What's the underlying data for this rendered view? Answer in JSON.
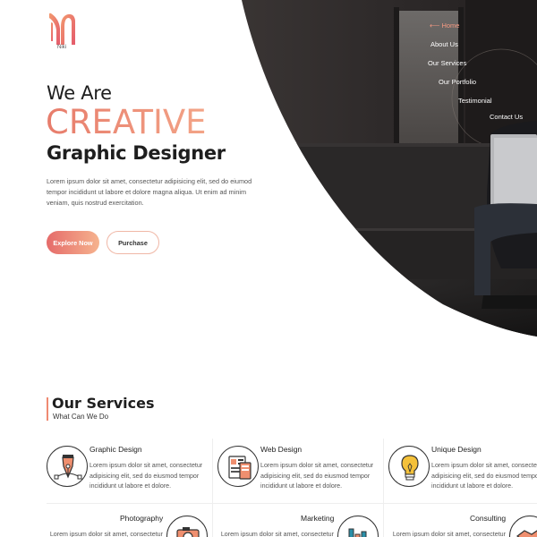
{
  "brand": {
    "name": "Niki",
    "colors": {
      "accent_start": "#e56b6a",
      "accent_end": "#f6b38e",
      "text_dark": "#1e1e1e"
    }
  },
  "nav": {
    "items": [
      {
        "label": "Home",
        "active": true
      },
      {
        "label": "About Us",
        "active": false
      },
      {
        "label": "Our Services",
        "active": false
      },
      {
        "label": "Our Portfolio",
        "active": false
      },
      {
        "label": "Testimonial",
        "active": false
      },
      {
        "label": "Contact Us",
        "active": false
      }
    ],
    "active_icon": "arrow-left-icon"
  },
  "hero": {
    "line1": "We Are",
    "line2": "CREATIVE",
    "line3": "Graphic Designer",
    "description": "Lorem ipsum dolor sit amet, consectetur adipisicing elit, sed do eiumod tempor incididunt ut labore et dolore magna aliqua. Ut enim ad minim veniam, quis nostrud exercitation.",
    "primary_button": "Explore Now",
    "secondary_button": "Purchase"
  },
  "services": {
    "title": "Our Services",
    "subtitle": "What Can We Do",
    "items": [
      {
        "title": "Graphic Design",
        "icon": "pen-tool-icon",
        "description": "Lorem ipsum dolor sit amet, consectetur adipisicing elit, sed do eiusmod tempor incididunt ut labore et dolore."
      },
      {
        "title": "Web Design",
        "icon": "web-layout-icon",
        "description": "Lorem ipsum dolor sit amet, consectetur adipisicing elit, sed do eiusmod tempor incididunt ut labore et dolore."
      },
      {
        "title": "Unique Design",
        "icon": "lightbulb-icon",
        "description": "Lorem ipsum dolor sit amet, consectetur adipisicing elit, sed do eiusmod tempor incididunt ut labore et dolore."
      },
      {
        "title": "Photography",
        "icon": "camera-icon",
        "description": "Lorem ipsum dolor sit amet, consectetur"
      },
      {
        "title": "Marketing",
        "icon": "bar-chart-icon",
        "description": "Lorem ipsum dolor sit amet, consectetur"
      },
      {
        "title": "Consulting",
        "icon": "handshake-icon",
        "description": "Lorem ipsum dolor sit amet, consectetur"
      }
    ]
  }
}
